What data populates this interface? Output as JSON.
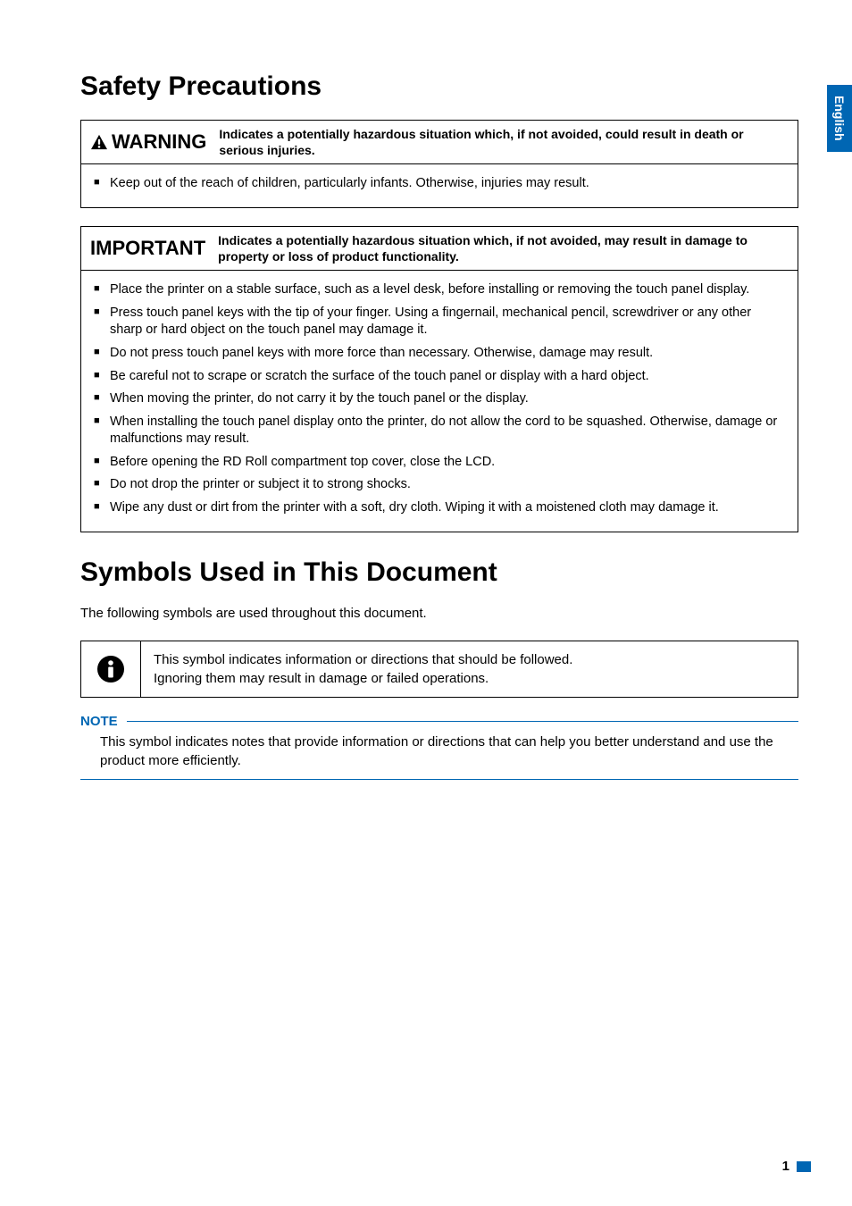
{
  "side_tab": "English",
  "heading1": "Safety Precautions",
  "warning": {
    "title": "WARNING",
    "description": "Indicates a potentially hazardous situation which, if not avoided, could result in death or serious injuries.",
    "items": [
      "Keep out of the reach of children, particularly infants. Otherwise, injuries may result."
    ]
  },
  "important": {
    "title": "IMPORTANT",
    "description": "Indicates a potentially hazardous situation which, if not avoided, may result in damage to property or loss of product functionality.",
    "items": [
      "Place the printer on a stable surface, such as a level desk, before installing or removing the touch panel display.",
      "Press touch panel keys with the tip of your finger. Using a fingernail, mechanical pencil, screwdriver or any other sharp or hard object on the touch panel may damage it.",
      "Do not press touch panel keys with more force than necessary. Otherwise, damage may result.",
      "Be careful not to scrape or scratch the surface of the touch panel or display with a hard object.",
      "When moving the printer, do not carry it by the touch panel or the display.",
      "When installing the touch panel display onto the printer, do not allow the cord to be squashed. Otherwise, damage or malfunctions may result.",
      "Before opening the RD Roll compartment top cover, close the LCD.",
      "Do not drop the printer or subject it to strong shocks.",
      "Wipe any dust or dirt from the printer with a soft, dry cloth. Wiping it with a moistened cloth may damage it."
    ]
  },
  "heading2": "Symbols Used in This Document",
  "symbols_intro": "The following symbols are used throughout this document.",
  "info_symbol": {
    "line1": "This symbol indicates information or directions that should be followed.",
    "line2": "Ignoring them may result in damage or failed operations."
  },
  "note": {
    "label": "NOTE",
    "body": "This symbol indicates notes that provide information or directions that can help you better understand and use the product more efficiently."
  },
  "page_number": "1"
}
